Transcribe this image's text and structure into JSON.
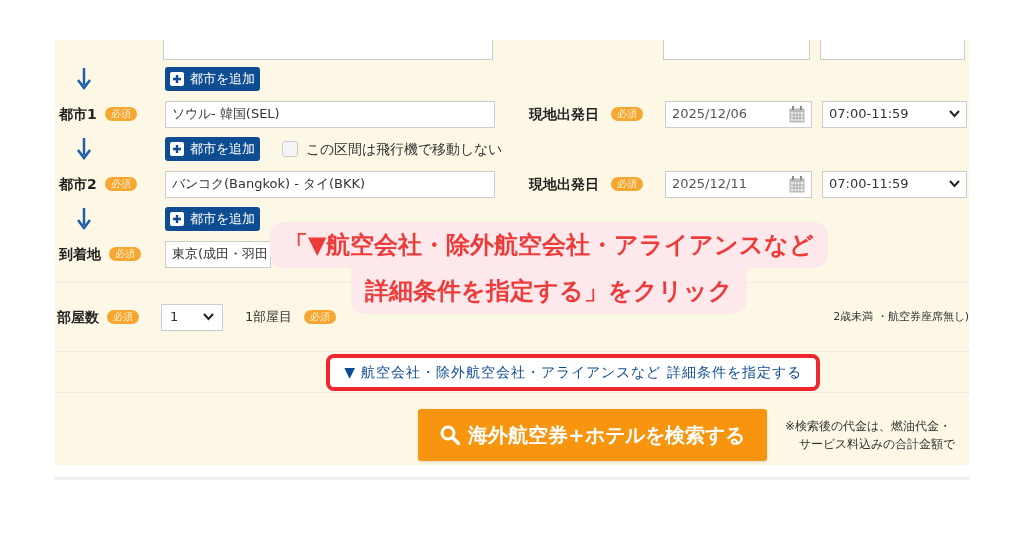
{
  "route": [
    {
      "kind": "add",
      "button": "都市を追加"
    },
    {
      "kind": "city",
      "label": "都市1",
      "badge": "必須",
      "value": "ソウル- 韓国(SEL)",
      "date_label": "現地出発日",
      "date_badge": "必須",
      "date": "2025/12/06",
      "time": "07:00-11:59"
    },
    {
      "kind": "add",
      "button": "都市を追加",
      "checkbox": {
        "label": "この区間は飛行機で移動しない",
        "checked": false
      }
    },
    {
      "kind": "city",
      "label": "都市2",
      "badge": "必須",
      "value": "バンコク(Bangkok) - タイ(BKK)",
      "date_label": "現地出発日",
      "date_badge": "必須",
      "date": "2025/12/11",
      "time": "07:00-11:59"
    },
    {
      "kind": "add",
      "button": "都市を追加"
    },
    {
      "kind": "arrival",
      "label": "到着地",
      "badge": "必須",
      "value": "東京(成田・羽田"
    }
  ],
  "rooms": {
    "label": "部屋数",
    "badge": "必須",
    "count": "1",
    "room_label": "1部屋目",
    "room_badge": "必須",
    "infant_note": "2歳未満 ・航空券座席無し)"
  },
  "details_link": "▼ 航空会社・除外航空会社・アライアンスなど 詳細条件を指定する",
  "search_button": "海外航空券+ホテルを検索する",
  "note_lines": [
    "※検索後の代金は、燃油代金・",
    "サービス料込みの合計金額で"
  ],
  "callout": {
    "lines": [
      "「▼航空会社・除外航空会社・アライアンスなど",
      "詳細条件を指定する」をクリック"
    ]
  }
}
